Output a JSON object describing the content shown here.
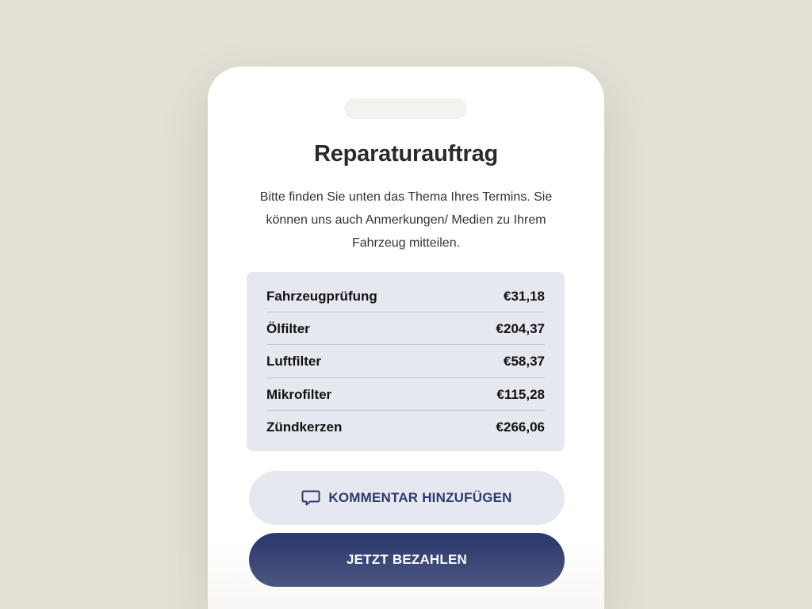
{
  "screen": {
    "title": "Reparaturauftrag",
    "description": "Bitte finden Sie unten das Thema Ihres Termins. Sie können uns auch Anmerkungen/ Medien zu Ihrem Fahrzeug mitteilen."
  },
  "items": [
    {
      "label": "Fahrzeugprüfung",
      "price": "€31,18"
    },
    {
      "label": "Ölfilter",
      "price": "€204,37"
    },
    {
      "label": "Luftfilter",
      "price": "€58,37"
    },
    {
      "label": "Mikrofilter",
      "price": "€115,28"
    },
    {
      "label": "Zündkerzen",
      "price": "€266,06"
    }
  ],
  "buttons": {
    "comment_label": "KOMMENTAR HINZUFÜGEN",
    "comment_icon": "comment-icon",
    "pay_label": "JETZT BEZAHLEN"
  },
  "colors": {
    "background": "#e4e0d6",
    "accent": "#2d3a6e",
    "card": "#e6e8ef"
  }
}
